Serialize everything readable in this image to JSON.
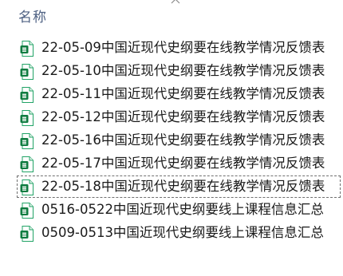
{
  "header": {
    "name_column_label": "名称",
    "sort_indicator_icon": "sort-ascending-caret-icon"
  },
  "files": [
    {
      "name": "22-05-09中国近现代史纲要在线教学情况反馈表",
      "icon": "excel-spreadsheet-icon",
      "focused": false
    },
    {
      "name": "22-05-10中国近现代史纲要在线教学情况反馈表",
      "icon": "excel-spreadsheet-icon",
      "focused": false
    },
    {
      "name": "22-05-11中国近现代史纲要在线教学情况反馈表",
      "icon": "excel-spreadsheet-icon",
      "focused": false
    },
    {
      "name": "22-05-12中国近现代史纲要在线教学情况反馈表",
      "icon": "excel-spreadsheet-icon",
      "focused": false
    },
    {
      "name": "22-05-16中国近现代史纲要在线教学情况反馈表",
      "icon": "excel-spreadsheet-icon",
      "focused": false
    },
    {
      "name": "22-05-17中国近现代史纲要在线教学情况反馈表",
      "icon": "excel-spreadsheet-icon",
      "focused": false
    },
    {
      "name": "22-05-18中国近现代史纲要在线教学情况反馈表",
      "icon": "excel-spreadsheet-icon",
      "focused": true
    },
    {
      "name": "0516-0522中国近现代史纲要线上课程信息汇总",
      "icon": "excel-spreadsheet-icon",
      "focused": false
    },
    {
      "name": "0509-0513中国近现代史纲要线上课程信息汇总",
      "icon": "excel-spreadsheet-icon",
      "focused": false
    }
  ],
  "colors": {
    "header_text": "#4d6082",
    "excel_green": "#21a366",
    "excel_dark_green": "#107c41",
    "focus_border": "#6f6f6f"
  }
}
